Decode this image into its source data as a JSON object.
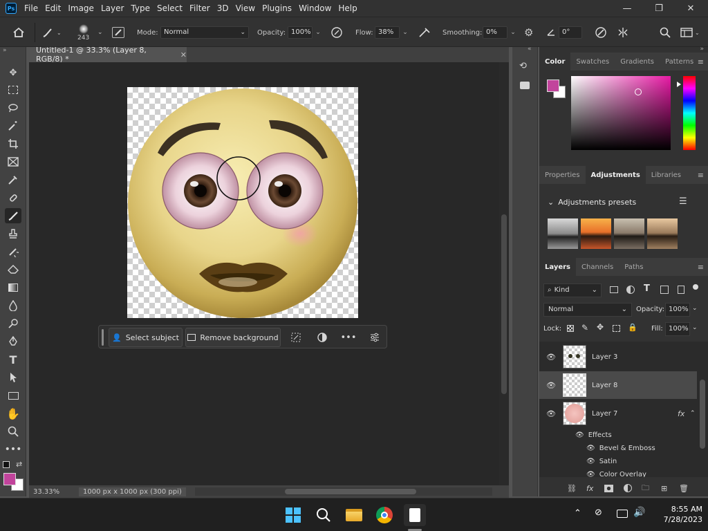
{
  "app": {
    "logo_text": "Ps"
  },
  "menu": [
    "File",
    "Edit",
    "Image",
    "Layer",
    "Type",
    "Select",
    "Filter",
    "3D",
    "View",
    "Plugins",
    "Window",
    "Help"
  ],
  "window_controls": {
    "minimize": "—",
    "restore": "❐",
    "close": "✕"
  },
  "options": {
    "brush_size": "243",
    "mode_label": "Mode:",
    "mode_value": "Normal",
    "opacity_label": "Opacity:",
    "opacity_value": "100%",
    "flow_label": "Flow:",
    "flow_value": "38%",
    "smoothing_label": "Smoothing:",
    "smoothing_value": "0%",
    "angle_value": "0°"
  },
  "document": {
    "tab_title": "Untitled-1 @ 33.3% (Layer 8, RGB/8) *",
    "zoom": "33.33%",
    "doc_size": "1000 px x 1000 px (300 ppi)"
  },
  "contextual_bar": {
    "select_subject": "Select subject",
    "remove_background": "Remove background"
  },
  "color_panel": {
    "tabs": [
      "Color",
      "Swatches",
      "Gradients",
      "Patterns"
    ],
    "foreground": "#c2449c",
    "background": "#ffffff"
  },
  "adjustments_panel": {
    "tabs": [
      "Properties",
      "Adjustments",
      "Libraries"
    ],
    "presets_title": "Adjustments presets"
  },
  "layers_panel": {
    "tabs": [
      "Layers",
      "Channels",
      "Paths"
    ],
    "filter_kind": "Kind",
    "blend_mode": "Normal",
    "opacity_label": "Opacity:",
    "opacity_value": "100%",
    "lock_label": "Lock:",
    "fill_label": "Fill:",
    "fill_value": "100%",
    "layers": [
      {
        "name": "Layer 3",
        "selected": false
      },
      {
        "name": "Layer 8",
        "selected": true
      },
      {
        "name": "Layer 7",
        "selected": false,
        "fx": "fx"
      }
    ],
    "effects_label": "Effects",
    "effects": [
      "Bevel & Emboss",
      "Satin",
      "Color Overlay"
    ]
  },
  "taskbar": {
    "time": "8:55 AM",
    "date": "7/28/2023"
  },
  "colors": {
    "accent": "#31a8ff",
    "foreground_color": "#c2449c"
  }
}
